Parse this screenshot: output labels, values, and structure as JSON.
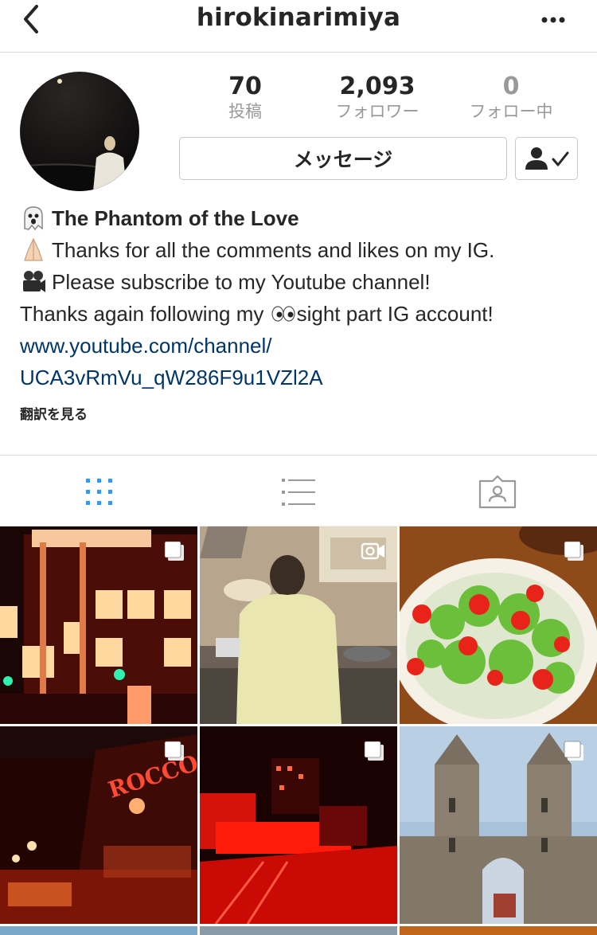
{
  "header": {
    "title": "hirokinarimiya",
    "back_icon": "chevron-left-icon",
    "more_icon": "more-dots-icon"
  },
  "stats": [
    {
      "value": "70",
      "label": "投稿"
    },
    {
      "value": "2,093",
      "label": "フォロワー"
    },
    {
      "value": "0",
      "label": "フォロー中"
    }
  ],
  "buttons": {
    "message_label": "メッセージ",
    "following_icon": "person-check-icon"
  },
  "bio": {
    "name": "The Phantom of the Love",
    "line1": "Thanks for all the comments and likes on my IG.",
    "line2": "Please subscribe to my Youtube channel!",
    "line3_a": "Thanks again following my ",
    "line3_b": "sight part IG account!",
    "link_line1": "www.youtube.com/channel/",
    "link_line2": "UCA3vRmVu_qW286F9u1VZl2A",
    "emojis": [
      "ghost-emoji",
      "folded-hands-emoji",
      "movie-camera-emoji",
      "eyes-emoji"
    ]
  },
  "translate_label": "翻訳を見る",
  "tabs": [
    {
      "icon": "grid-icon",
      "active": true
    },
    {
      "icon": "list-icon",
      "active": false
    },
    {
      "icon": "tagged-person-icon",
      "active": false
    }
  ],
  "posts": [
    {
      "subject": "building at night",
      "badge": "multi-photo-icon"
    },
    {
      "subject": "person in kitchen",
      "badge": "video-icon"
    },
    {
      "subject": "tomato salad",
      "badge": "multi-photo-icon"
    },
    {
      "subject": "Rocco sign",
      "badge": "multi-photo-icon"
    },
    {
      "subject": "red tram street",
      "badge": "multi-photo-icon"
    },
    {
      "subject": "castle gate",
      "badge": "multi-photo-icon"
    }
  ],
  "colors": {
    "link": "#003569",
    "tab_active": "#3897f0",
    "tab_inactive": "#999999",
    "border": "#dbdbdb"
  }
}
